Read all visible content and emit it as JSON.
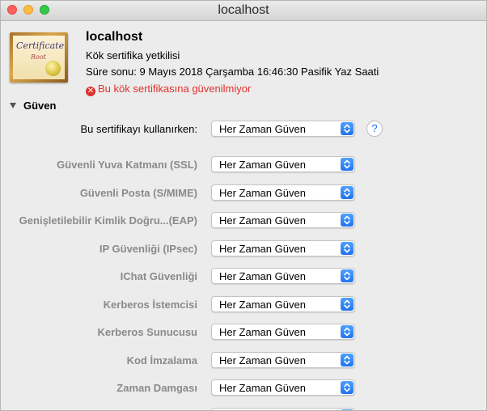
{
  "window": {
    "title": "localhost"
  },
  "certificate": {
    "thumb_line1": "Certificate",
    "thumb_line2": "Root",
    "name": "localhost",
    "type": "Kök sertifika yetkilisi",
    "expiry": "Süre sonu: 9 Mayıs 2018 Çarşamba 16:46:30 Pasifik Yaz Saati",
    "warning": "Bu kök sertifikasına güvenilmiyor",
    "warning_color": "#e0302b"
  },
  "trust": {
    "section_label": "Güven",
    "when_using": {
      "label": "Bu sertifikayı kullanırken:",
      "value": "Her Zaman Güven"
    },
    "help_glyph": "?",
    "settings": [
      {
        "label": "Güvenli Yuva Katmanı (SSL)",
        "value": "Her Zaman Güven"
      },
      {
        "label": "Güvenli Posta (S/MIME)",
        "value": "Her Zaman Güven"
      },
      {
        "label": "Genişletilebilir Kimlik Doğru...(EAP)",
        "value": "Her Zaman Güven"
      },
      {
        "label": "IP Güvenliği (IPsec)",
        "value": "Her Zaman Güven"
      },
      {
        "label": "IChat Güvenliği",
        "value": "Her Zaman Güven"
      },
      {
        "label": "Kerberos İstemcisi",
        "value": "Her Zaman Güven"
      },
      {
        "label": "Kerberos Sunucusu",
        "value": "Her Zaman Güven"
      },
      {
        "label": "Kod İmzalama",
        "value": "Her Zaman Güven"
      },
      {
        "label": "Zaman Damgası",
        "value": "Her Zaman Güven"
      },
      {
        "label": "",
        "value": ""
      }
    ]
  },
  "icons": {
    "close": "close-traffic-light-icon",
    "minimize": "minimize-traffic-light-icon",
    "zoom": "zoom-traffic-light-icon",
    "certificate": "certificate-icon",
    "error": "error-circle-icon",
    "disclosure": "disclosure-triangle-icon",
    "stepper": "up-down-chevron-icon",
    "help": "help-icon"
  }
}
